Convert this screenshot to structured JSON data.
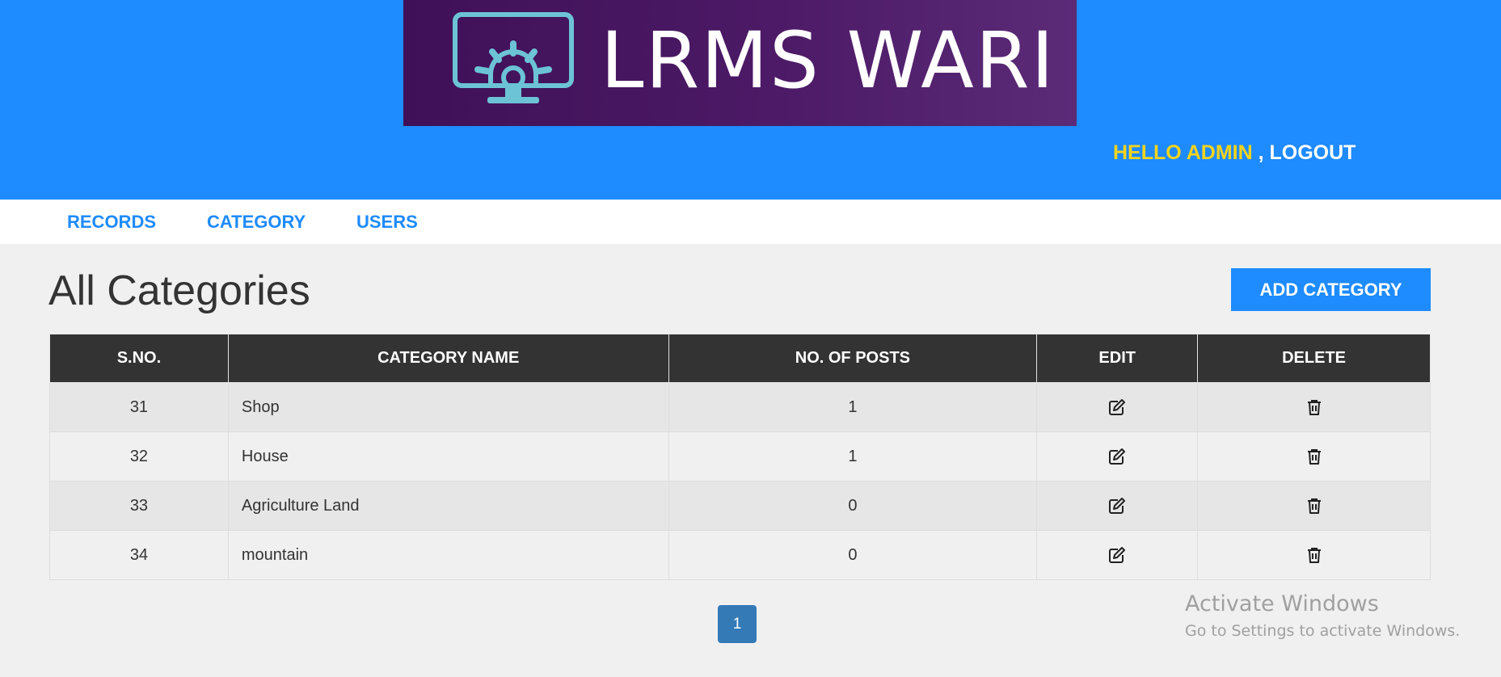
{
  "header": {
    "logo_text": "LRMS WARI",
    "greeting": "HELLO ADMIN",
    "separator": " , ",
    "logout_label": "LOGOUT"
  },
  "menu": {
    "items": [
      {
        "label": "RECORDS"
      },
      {
        "label": "CATEGORY"
      },
      {
        "label": "USERS"
      }
    ]
  },
  "main": {
    "title": "All Categories",
    "add_button_label": "ADD CATEGORY"
  },
  "table": {
    "columns": [
      "S.NO.",
      "CATEGORY NAME",
      "NO. OF POSTS",
      "EDIT",
      "DELETE"
    ],
    "rows": [
      {
        "sno": "31",
        "name": "Shop",
        "posts": "1"
      },
      {
        "sno": "32",
        "name": "House",
        "posts": "1"
      },
      {
        "sno": "33",
        "name": "Agriculture Land",
        "posts": "0"
      },
      {
        "sno": "34",
        "name": "mountain",
        "posts": "0"
      }
    ],
    "edit_icon": "edit-icon",
    "delete_icon": "trash-icon"
  },
  "pagination": {
    "current_page": "1"
  },
  "watermark": {
    "title": "Activate Windows",
    "subtitle": "Go to Settings to activate Windows."
  },
  "colors": {
    "header_bg": "#1e8bff",
    "logo_bg": "#4c1a66",
    "greeting": "#f5d41a",
    "table_header_bg": "#333333",
    "pager_bg": "#337ab7"
  }
}
